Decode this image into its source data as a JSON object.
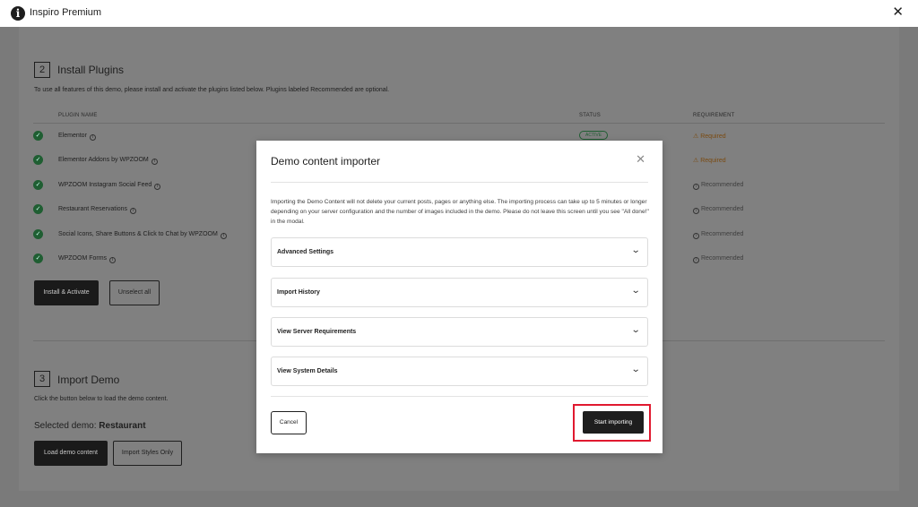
{
  "topbar": {
    "logo": "i",
    "title": "Inspiro Premium",
    "close": "✕"
  },
  "install": {
    "number": "2",
    "title": "Install Plugins",
    "description": "To use all features of this demo, please install and activate the plugins listed below. Plugins labeled Recommended are optional.",
    "columns": {
      "name": "PLUGIN NAME",
      "status": "STATUS",
      "requirement": "REQUIREMENT"
    },
    "plugins": [
      {
        "name": "Elementor",
        "status": "ACTIVE",
        "requirement": "Required"
      },
      {
        "name": "Elementor Addons by WPZOOM",
        "status": "",
        "requirement": "Required"
      },
      {
        "name": "WPZOOM Instagram Social Feed",
        "status": "",
        "requirement": "Recommended"
      },
      {
        "name": "Restaurant Reservations",
        "status": "",
        "requirement": "Recommended"
      },
      {
        "name": "Social Icons, Share Buttons & Click to Chat by WPZOOM",
        "status": "",
        "requirement": "Recommended"
      },
      {
        "name": "WPZOOM Forms",
        "status": "",
        "requirement": "Recommended"
      }
    ],
    "install_button": "Install & Activate",
    "unselect_button": "Unselect all"
  },
  "import": {
    "number": "3",
    "title": "Import Demo",
    "description": "Click the button below to load the demo content.",
    "selected_label": "Selected demo:",
    "selected_value": "Restaurant",
    "load_button": "Load demo content",
    "styles_button": "Import Styles Only"
  },
  "modal": {
    "title": "Demo content importer",
    "close": "✕",
    "text": "Importing the Demo Content will not delete your current posts, pages or anything else. The importing process can take up to 5 minutes or longer depending on your server configuration and the number of images included in the demo. Please do not leave this screen until you see \"All done!\" in the modal.",
    "sections": [
      "Advanced Settings",
      "Import History",
      "View Server Requirements",
      "View System Details"
    ],
    "chevron": "⌄",
    "cancel_button": "Cancel",
    "start_button": "Start importing"
  }
}
